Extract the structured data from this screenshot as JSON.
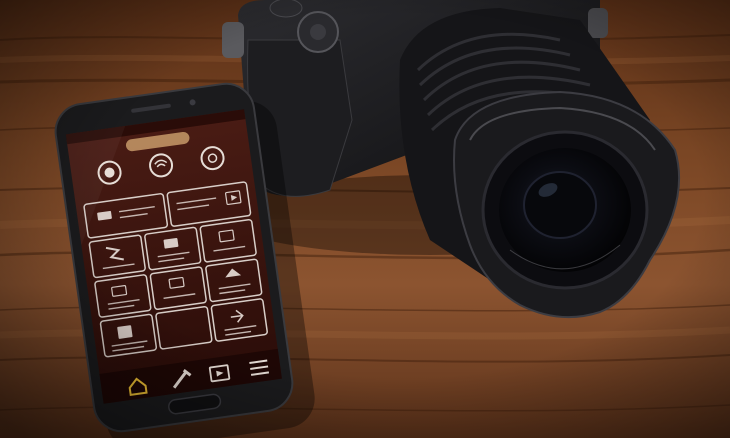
{
  "scene": {
    "colors": {
      "table_dark": "#2a150b",
      "table_mid": "#6a3b1d",
      "table_light": "#9a6438",
      "phone_frame": "#1b1b1d",
      "screen_bg": "#3a140f",
      "screen_tile_border": "#d8cec8",
      "nav_bar": "#f1c235",
      "camera_body": "#141416",
      "lens_inner": "#050507"
    },
    "icons": {
      "home": "home-icon",
      "remote": "wand-icon",
      "playback": "play-icon",
      "menu": "menu-icon"
    }
  }
}
